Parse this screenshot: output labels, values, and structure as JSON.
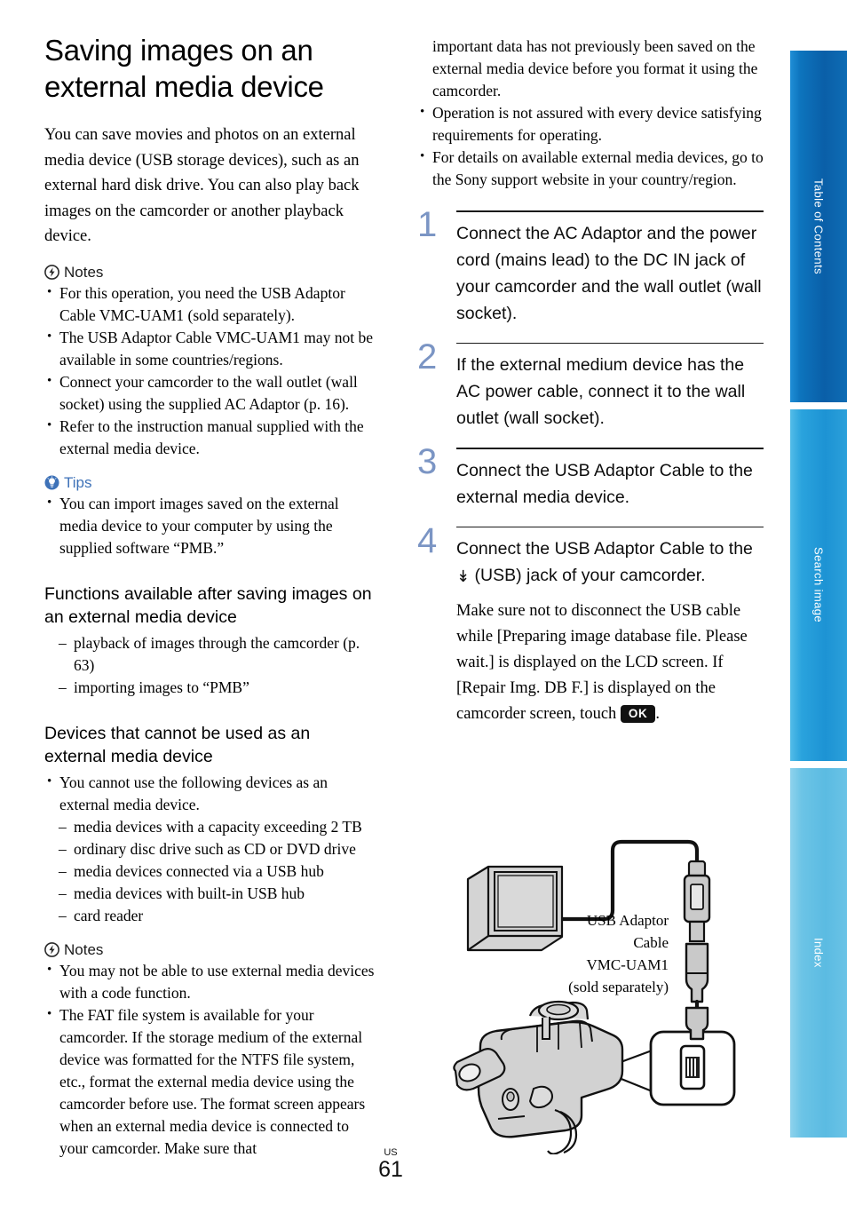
{
  "document": {
    "title": "Saving images on an external media device",
    "title_lines": [
      "Saving images on an",
      "external media device"
    ],
    "page_number": "61",
    "locale_code": "US"
  },
  "left_column": {
    "intro_paragraph": "You can save movies and photos on an external media device (USB storage devices), such as an external hard disk drive. You can also play back images on the camcorder or another playback device.",
    "notes_1": {
      "icon": "notes-lightning-icon",
      "label": "Notes",
      "items": [
        "For this operation, you need the USB Adaptor Cable VMC-UAM1 (sold separately).",
        "The USB Adaptor Cable VMC-UAM1 may not be available in some countries/regions.",
        "Connect your camcorder to the wall outlet (wall socket) using the supplied AC Adaptor (p. 16).",
        "Refer to the instruction manual supplied with the external media device."
      ]
    },
    "tips": {
      "icon": "tips-lightbulb-icon",
      "label": "Tips",
      "items": [
        "You can import images saved on the external media device to your computer by using the supplied software “PMB.”"
      ]
    },
    "section_functions": {
      "heading": "Functions available after saving images on an external media device",
      "dash_items": [
        "playback of images through the camcorder (p. 63)",
        "importing images to “PMB”"
      ]
    },
    "section_devices": {
      "heading": "Devices that cannot be used as an external media device",
      "bullet_items": [
        "You cannot use the following devices as an external media device."
      ],
      "dash_items": [
        "media devices with a capacity exceeding 2 TB",
        "ordinary disc drive such as CD or DVD drive",
        "media devices connected via a USB hub",
        "media devices with built-in USB hub",
        "card reader"
      ]
    },
    "notes_2": {
      "icon": "notes-lightning-icon",
      "label": "Notes",
      "items": [
        "You may not be able to use external media devices with a code function.",
        "The FAT file system is available for your camcorder. If the storage medium of the external device was formatted for the NTFS file system, etc., format the external media device using the camcorder before use. The format screen appears when an external media device is connected to your camcorder. Make sure that"
      ]
    }
  },
  "right_column": {
    "continued_notes": {
      "continuation_text": "important data has not previously been saved on the external media device before you format it using the camcorder.",
      "items": [
        "Operation is not assured with every device satisfying requirements for operating.",
        "For details on available external media devices, go to the Sony support website in your country/region."
      ]
    },
    "steps": [
      {
        "number": "1",
        "text": "Connect the AC Adaptor and the power cord (mains lead) to the DC IN jack of your camcorder and the wall outlet (wall socket)."
      },
      {
        "number": "2",
        "text": "If the external medium device has the AC power cable, connect it to the wall outlet (wall socket)."
      },
      {
        "number": "3",
        "text": "Connect the USB Adaptor Cable to the external media device."
      },
      {
        "number": "4",
        "text_before_icon": "Connect the USB Adaptor Cable to the ",
        "usb_icon": "usb-trident-icon",
        "text_after_icon": " (USB) jack of your camcorder.",
        "note_before_key": "Make sure not to disconnect the USB cable while [Preparing image database file. Please wait.] is displayed on the LCD screen. If [Repair Img. DB F.] is displayed on the camcorder screen, touch ",
        "ok_key_label": "OK",
        "note_after_key": "."
      }
    ],
    "diagram": {
      "caption_lines": [
        "USB Adaptor",
        "Cable",
        "VMC-UAM1",
        "(sold separately)"
      ],
      "parts": [
        "external-media-device",
        "usb-adaptor-cable",
        "camcorder",
        "usb-jack-callout"
      ]
    }
  },
  "side_tabs": [
    {
      "label": "Table of Contents",
      "color": "#0a5fa8"
    },
    {
      "label": "Search image",
      "color": "#1d93d4"
    },
    {
      "label": "Index",
      "color": "#5bbbe2"
    }
  ],
  "colors": {
    "step_number": "#7b95c4",
    "tips_accent": "#3e72b8",
    "key_bg": "#111111"
  }
}
